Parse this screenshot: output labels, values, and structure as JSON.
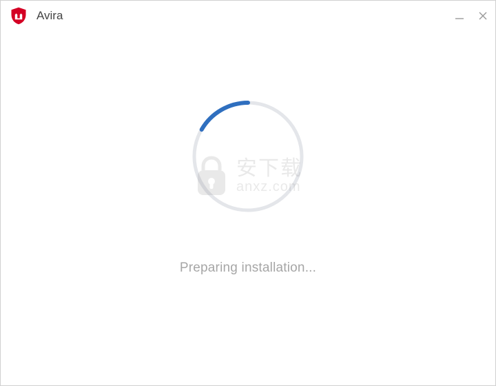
{
  "titlebar": {
    "app_name": "Avira",
    "brand_color": "#d40024"
  },
  "status": {
    "message": "Preparing installation..."
  },
  "spinner": {
    "track_color": "#e4e6ea",
    "arc_color": "#2f6fbf",
    "progress_degrees": 80
  },
  "watermark": {
    "text_top": "安下载",
    "text_bottom": "anxz.com"
  }
}
